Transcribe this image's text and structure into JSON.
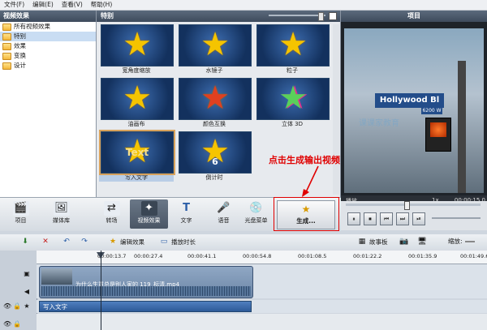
{
  "menu": [
    "文件(F)",
    "编辑(E)",
    "查看(V)",
    "帮助(H)"
  ],
  "left_panel": {
    "title": "视频效果",
    "items": [
      {
        "label": "所有视频效果",
        "selected": false
      },
      {
        "label": "特别",
        "selected": true
      },
      {
        "label": "效果",
        "selected": false
      },
      {
        "label": "变换",
        "selected": false
      },
      {
        "label": "设计",
        "selected": false
      }
    ]
  },
  "effects_panel": {
    "title": "特别",
    "tiles": [
      {
        "label": "宽角度缩放",
        "selected": false
      },
      {
        "label": "水镜子",
        "selected": false
      },
      {
        "label": "粒子",
        "selected": false
      },
      {
        "label": "油画布",
        "selected": false
      },
      {
        "label": "颜色互换",
        "selected": false
      },
      {
        "label": "立体 3D",
        "selected": false
      },
      {
        "label": "写入文字",
        "selected": true,
        "overlay": "Text"
      },
      {
        "label": "倒计时",
        "selected": false,
        "overlay": "6"
      }
    ]
  },
  "preview": {
    "title": "项目",
    "sign_text": "Hollywood Bl",
    "sign_sub": "6200 W",
    "watermark": "课课家教育",
    "position_label": "播放",
    "speed": "1x",
    "timecode": "00:00:15.0"
  },
  "player_buttons": [
    "⏸",
    "⏹",
    "⏮",
    "⏭",
    "⏯"
  ],
  "toolbar": {
    "buttons": [
      {
        "label": "项目",
        "icon": "film-icon",
        "active": false
      },
      {
        "label": "媒体库",
        "icon": "media-icon",
        "active": false
      },
      {
        "label": "转场",
        "icon": "transition-icon",
        "active": false
      },
      {
        "label": "视频效果",
        "icon": "video-effects-icon",
        "active": true
      },
      {
        "label": "文字",
        "icon": "text-icon",
        "active": false
      },
      {
        "label": "语音",
        "icon": "microphone-icon",
        "active": false
      },
      {
        "label": "光盘菜单",
        "icon": "disc-menu-icon",
        "active": false
      }
    ],
    "produce_label": "生成..."
  },
  "annotation": {
    "text": "点击生成输出视频",
    "color": "#e00000"
  },
  "timeline_toolbar": {
    "edit_effects": "编辑效果",
    "play_duration": "播放时长",
    "storyboard": "故事板",
    "zoom_label": "缩放:"
  },
  "ruler": [
    "00:00:13.7",
    "00:00:27.4",
    "00:00:41.1",
    "00:00:54.8",
    "00:01:08.5",
    "00:01:22.2",
    "00:01:35.9",
    "00:01:49.6"
  ],
  "tracks": {
    "video_clip_title": "为什么生意总是别人家的 119_标清.mp4",
    "text_clip_label": "写入文字"
  },
  "colors": {
    "header_dark": "#4a5868",
    "selection_blue": "#c9ddf3",
    "clip_blue": "#2d5a98"
  }
}
